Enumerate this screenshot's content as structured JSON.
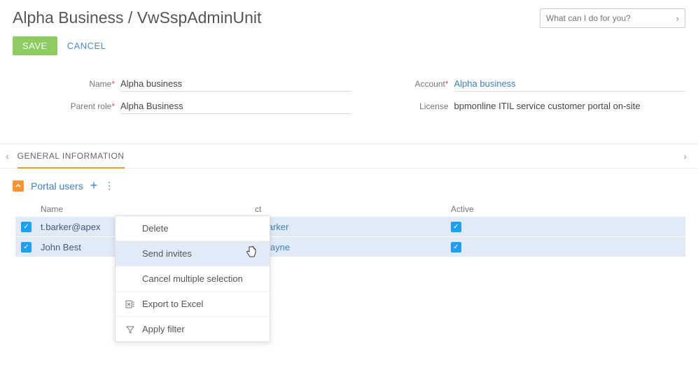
{
  "breadcrumb": "Alpha Business / VwSspAdminUnit",
  "search": {
    "placeholder": "What can I do for you?"
  },
  "actions": {
    "save": "SAVE",
    "cancel": "CANCEL"
  },
  "form": {
    "name_label": "Name",
    "name_value": "Alpha business",
    "parent_label": "Parent role",
    "parent_value": "Alpha Business",
    "account_label": "Account",
    "account_value": "Alpha business",
    "license_label": "License",
    "license_value": "bpmonline ITIL service customer portal on-site"
  },
  "section_tab": "GENERAL INFORMATION",
  "detail_title": "Portal users",
  "grid": {
    "headers": {
      "name": "Name",
      "contact": "ct",
      "active": "Active",
      "contact_full": "Contact"
    },
    "rows": [
      {
        "name": "t.barker@apex",
        "name_trunc": "t.barker@apex",
        "contact": "s Barker",
        "active": true
      },
      {
        "name": "John Best",
        "contact": "y Wayne",
        "active": true
      }
    ]
  },
  "menu": {
    "delete": "Delete",
    "send_invites": "Send invites",
    "cancel_multi": "Cancel multiple selection",
    "export": "Export to Excel",
    "apply_filter": "Apply filter"
  }
}
